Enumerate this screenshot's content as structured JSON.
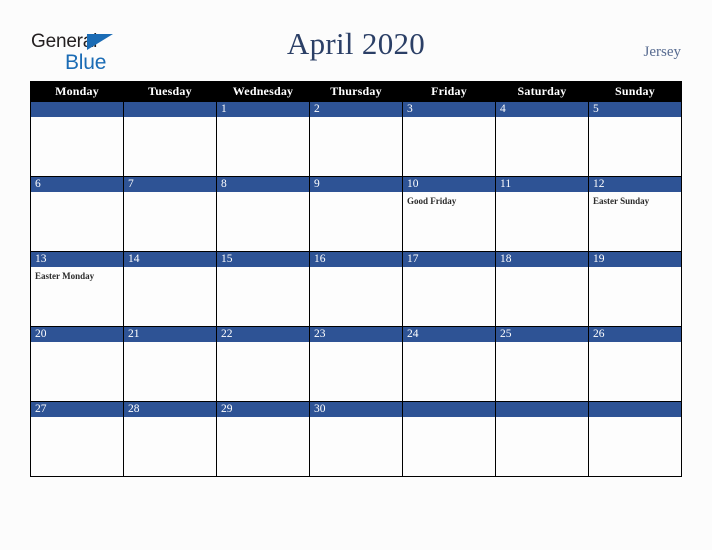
{
  "brand": {
    "line1": "General",
    "line2": "Blue",
    "triangle_icon": "triangle-icon",
    "line1_color": "#231f20",
    "line2_color": "#1b6cb5"
  },
  "header": {
    "title": "April 2020",
    "location": "Jersey",
    "title_color": "#2b3f66",
    "location_color": "#576b90"
  },
  "theme": {
    "header_row_bg": "#000000",
    "header_row_text": "#ffffff",
    "day_bar_bg": "#2e5395",
    "day_bar_text": "#ffffff",
    "cell_bg": "#fdfdfd",
    "grid_line": "#000000",
    "page_bg": "#fcfcfc"
  },
  "calendar": {
    "month": "April",
    "year": "2020",
    "weekday_headers": [
      "Monday",
      "Tuesday",
      "Wednesday",
      "Thursday",
      "Friday",
      "Saturday",
      "Sunday"
    ],
    "weeks": [
      [
        {
          "number": "",
          "events": []
        },
        {
          "number": "",
          "events": []
        },
        {
          "number": "1",
          "events": []
        },
        {
          "number": "2",
          "events": []
        },
        {
          "number": "3",
          "events": []
        },
        {
          "number": "4",
          "events": []
        },
        {
          "number": "5",
          "events": []
        }
      ],
      [
        {
          "number": "6",
          "events": []
        },
        {
          "number": "7",
          "events": []
        },
        {
          "number": "8",
          "events": []
        },
        {
          "number": "9",
          "events": []
        },
        {
          "number": "10",
          "events": [
            "Good Friday"
          ]
        },
        {
          "number": "11",
          "events": []
        },
        {
          "number": "12",
          "events": [
            "Easter Sunday"
          ]
        }
      ],
      [
        {
          "number": "13",
          "events": [
            "Easter Monday"
          ]
        },
        {
          "number": "14",
          "events": []
        },
        {
          "number": "15",
          "events": []
        },
        {
          "number": "16",
          "events": []
        },
        {
          "number": "17",
          "events": []
        },
        {
          "number": "18",
          "events": []
        },
        {
          "number": "19",
          "events": []
        }
      ],
      [
        {
          "number": "20",
          "events": []
        },
        {
          "number": "21",
          "events": []
        },
        {
          "number": "22",
          "events": []
        },
        {
          "number": "23",
          "events": []
        },
        {
          "number": "24",
          "events": []
        },
        {
          "number": "25",
          "events": []
        },
        {
          "number": "26",
          "events": []
        }
      ],
      [
        {
          "number": "27",
          "events": []
        },
        {
          "number": "28",
          "events": []
        },
        {
          "number": "29",
          "events": []
        },
        {
          "number": "30",
          "events": []
        },
        {
          "number": "",
          "events": []
        },
        {
          "number": "",
          "events": []
        },
        {
          "number": "",
          "events": []
        }
      ]
    ]
  }
}
